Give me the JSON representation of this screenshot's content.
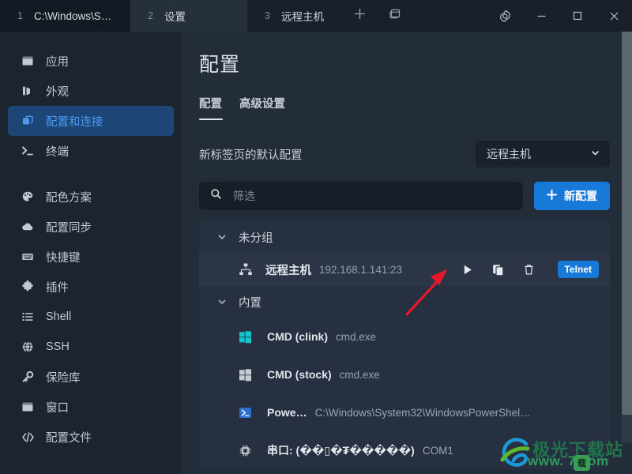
{
  "titlebar": {
    "tabs": [
      {
        "num": "1",
        "title": "C:\\Windows\\SY…"
      },
      {
        "num": "2",
        "title": "设置"
      },
      {
        "num": "3",
        "title": "远程主机"
      }
    ],
    "actions": [
      {
        "name": "new-tab-button",
        "icon": "plus-icon"
      },
      {
        "name": "split-pane-button",
        "icon": "window-split-icon"
      }
    ],
    "window_controls": [
      {
        "name": "settings-button",
        "icon": "gear-icon"
      },
      {
        "name": "minimize-button",
        "icon": "minimize-icon"
      },
      {
        "name": "maximize-button",
        "icon": "maximize-icon"
      },
      {
        "name": "close-button",
        "icon": "close-icon"
      }
    ]
  },
  "sidebar": {
    "items": [
      {
        "label": "应用",
        "icon": "window-icon",
        "active": false
      },
      {
        "label": "外观",
        "icon": "palette-appearance-icon",
        "active": false
      },
      {
        "label": "配置和连接",
        "icon": "layers-icon",
        "active": true
      },
      {
        "label": "终端",
        "icon": "terminal-prompt-icon",
        "active": false
      },
      {
        "label": "配色方案",
        "icon": "color-palette-icon",
        "active": false
      },
      {
        "label": "配置同步",
        "icon": "cloud-icon",
        "active": false
      },
      {
        "label": "快捷键",
        "icon": "keyboard-icon",
        "active": false
      },
      {
        "label": "插件",
        "icon": "puzzle-icon",
        "active": false
      },
      {
        "label": "Shell",
        "icon": "list-icon",
        "active": false
      },
      {
        "label": "SSH",
        "icon": "globe-icon",
        "active": false
      },
      {
        "label": "保险库",
        "icon": "key-icon",
        "active": false
      },
      {
        "label": "窗口",
        "icon": "window-icon",
        "active": false
      },
      {
        "label": "配置文件",
        "icon": "code-brackets-icon",
        "active": false
      }
    ]
  },
  "main": {
    "title": "配置",
    "tabs": [
      {
        "label": "配置",
        "active": true
      },
      {
        "label": "高级设置",
        "active": false
      }
    ],
    "default_profile": {
      "label": "新标签页的默认配置",
      "selected": "远程主机"
    },
    "search": {
      "placeholder": "筛选",
      "value": "",
      "icon": "search-icon"
    },
    "new_profile_button": {
      "label": "新配置",
      "icon": "plus-icon"
    },
    "groups": [
      {
        "name": "未分组",
        "expanded": true,
        "profiles": [
          {
            "icon": "network-nodes-icon",
            "name": "远程主机",
            "address": "192.168.1.141:23",
            "badge": "Telnet",
            "actions": [
              "play-icon",
              "copy-icon",
              "trash-icon"
            ]
          }
        ]
      },
      {
        "name": "内置",
        "expanded": true,
        "profiles": [
          {
            "icon": "windows-logo-cyan-icon",
            "name": "CMD (clink)",
            "path": "cmd.exe"
          },
          {
            "icon": "windows-logo-gray-icon",
            "name": "CMD (stock)",
            "path": "cmd.exe"
          },
          {
            "icon": "powershell-icon",
            "name": "Powe…",
            "path": "C:\\Windows\\System32\\WindowsPowerShel…"
          },
          {
            "icon": "chip-icon",
            "name": "串口: (��▯�₮�����)",
            "path": "COM1"
          }
        ]
      }
    ]
  },
  "watermark": {
    "line1": "极光下载站",
    "line2": "www.   7.com",
    "badge": "载"
  },
  "colors": {
    "accent_blue": "#1779d8",
    "sidebar_active_bg": "#1d4677",
    "sidebar_active_text": "#4c9aee",
    "panel_bg": "#263040",
    "main_bg": "#232c39",
    "titlebar_bg": "#19202b",
    "arrow_red": "#e8172b"
  }
}
